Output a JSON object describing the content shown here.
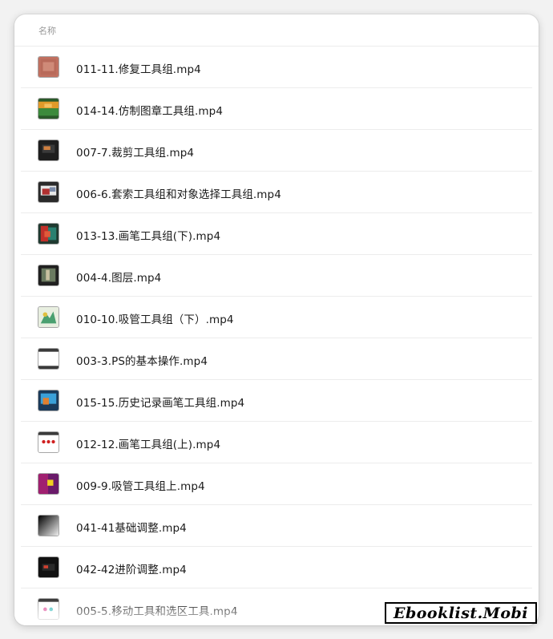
{
  "header": {
    "column_name": "名称"
  },
  "files": [
    {
      "name": "011-11.修复工具组.mp4",
      "icon": "video-thumbnail-icon"
    },
    {
      "name": "014-14.仿制图章工具组.mp4",
      "icon": "video-thumbnail-icon"
    },
    {
      "name": "007-7.裁剪工具组.mp4",
      "icon": "video-thumbnail-icon"
    },
    {
      "name": "006-6.套索工具组和对象选择工具组.mp4",
      "icon": "video-thumbnail-icon"
    },
    {
      "name": "013-13.画笔工具组(下).mp4",
      "icon": "video-thumbnail-icon"
    },
    {
      "name": "004-4.图层.mp4",
      "icon": "video-thumbnail-icon"
    },
    {
      "name": "010-10.吸管工具组（下）.mp4",
      "icon": "video-thumbnail-icon"
    },
    {
      "name": "003-3.PS的基本操作.mp4",
      "icon": "video-thumbnail-icon"
    },
    {
      "name": "015-15.历史记录画笔工具组.mp4",
      "icon": "video-thumbnail-icon"
    },
    {
      "name": "012-12.画笔工具组(上).mp4",
      "icon": "video-thumbnail-icon"
    },
    {
      "name": "009-9.吸管工具组上.mp4",
      "icon": "video-thumbnail-icon"
    },
    {
      "name": "041-41基础调整.mp4",
      "icon": "video-thumbnail-icon"
    },
    {
      "name": "042-42进阶调整.mp4",
      "icon": "video-thumbnail-icon"
    },
    {
      "name": "005-5.移动工具和选区工具.mp4",
      "icon": "video-thumbnail-icon"
    }
  ],
  "watermark": {
    "text": "Ebooklist.Mobi"
  }
}
